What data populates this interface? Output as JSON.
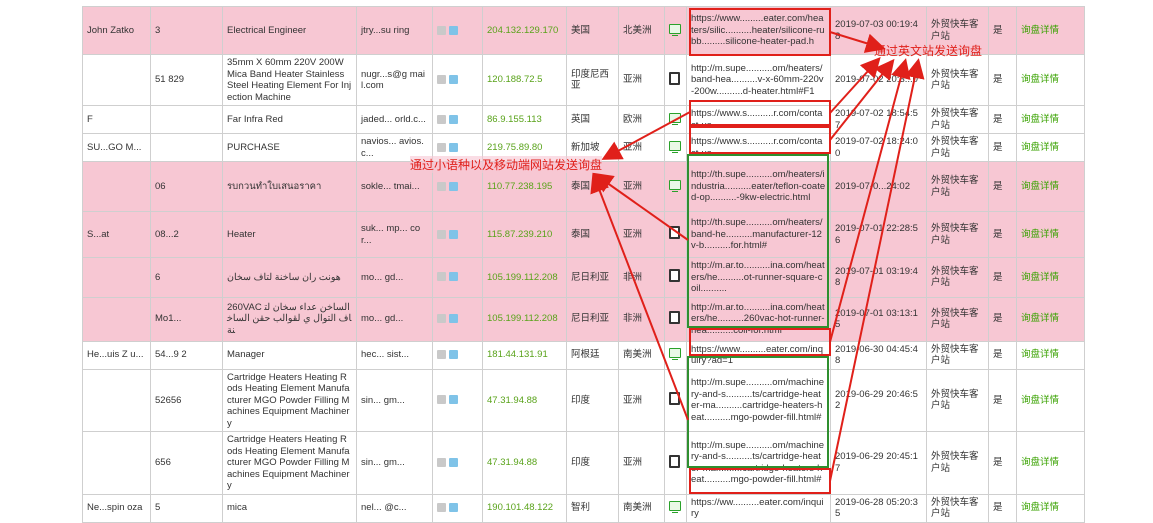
{
  "rows": [
    {
      "style": "pink",
      "row_height": 48,
      "name": "John Zatko",
      "phone": "3",
      "title": "Electrical Engineer",
      "email": "jtry...su ring",
      "ip": "204.132.129.170",
      "country": "美国",
      "region": "北美洲",
      "device": "pc",
      "url": "https://www.........eater.com/heaters/silic..........heater/silicone-rubb.........silicone-heater-pad.h",
      "time": "2019-07-03 00:19:48",
      "type": "外贸快车客户站",
      "flag": "是",
      "action": "询盘详情"
    },
    {
      "style": "white",
      "row_height": 44,
      "name": "",
      "phone": "51 829",
      "title": "35mm X 60mm 220V 200W Mica Band Heater Stainless Steel Heating Element For Injection Machine",
      "email": "nugr...s@g mail.com",
      "ip": "120.188.72.5",
      "country": "印度尼西亚",
      "region": "亚洲",
      "device": "mobile",
      "url": "http://m.supe..........om/heaters/band-hea..........v-x-60mm-220v-200w..........d-heater.html#F1",
      "time": "2019-07-02 20:3...0",
      "type": "外贸快车客户站",
      "flag": "是",
      "action": "询盘详情"
    },
    {
      "style": "white",
      "row_height": 26,
      "name": "F",
      "phone": "",
      "title": "Far Infra Red",
      "email": "jaded... orld.c...",
      "ip": "86.9.155.113",
      "country": "英国",
      "region": "欧洲",
      "device": "pc",
      "url": "https://www.s..........r.com/contact-us",
      "time": "2019-07-02 18:54:57",
      "type": "外贸快车客户站",
      "flag": "是",
      "action": "询盘详情"
    },
    {
      "style": "white",
      "row_height": 28,
      "name": "SU...GO M...",
      "phone": "",
      "title": "PURCHASE",
      "email": "navios... avios.c...",
      "ip": "219.75.89.80",
      "country": "新加坡",
      "region": "亚洲",
      "device": "pc",
      "url": "https://www.s..........r.com/contact-us",
      "time": "2019-07-02 18:24:00",
      "type": "外贸快车客户站",
      "flag": "是",
      "action": "询盘详情"
    },
    {
      "style": "pink",
      "row_height": 50,
      "name": "",
      "phone": "06",
      "title": "รบกวนทำใบเสนอราคา",
      "email": "sokle... tmai...",
      "ip": "110.77.238.195",
      "country": "泰国",
      "region": "亚洲",
      "device": "pc",
      "url": "http://th.supe..........om/heaters/industria..........eater/teflon-coated-op..........-9kw-electric.html",
      "time": "2019-07-0...24:02",
      "type": "外贸快车客户站",
      "flag": "是",
      "action": "询盘详情"
    },
    {
      "style": "pink",
      "row_height": 46,
      "name": "S...at",
      "phone": "08...2",
      "title": "Heater",
      "email": "suk... mp... cor...",
      "ip": "115.87.239.210",
      "country": "泰国",
      "region": "亚洲",
      "device": "mobile",
      "url": "http://th.supe..........om/heaters/band-he..........manufacturer-12v-b..........for.html#",
      "time": "2019-07-01 22:28:56",
      "type": "外贸快车客户站",
      "flag": "是",
      "action": "询盘详情"
    },
    {
      "style": "pink",
      "row_height": 38,
      "name": "",
      "phone": "6",
      "title": "هونت ران ساخنة لتاف سخان",
      "email": "mo... gd...",
      "ip": "105.199.112.208",
      "country": "尼日利亚",
      "region": "非洲",
      "device": "mobile",
      "url": "http://m.ar.to..........ina.com/heaters/he..........ot-runner-square-coil..........",
      "time": "2019-07-01 03:19:48",
      "type": "外贸快车客户站",
      "flag": "是",
      "action": "询盘详情"
    },
    {
      "style": "pink",
      "row_height": 44,
      "name": "",
      "phone": "Mo1...",
      "title": "260VAC الساخن عداء سخان لتاف التوال ي لقوالب حقن الساخنة",
      "email": "mo... gd...",
      "ip": "105.199.112.208",
      "country": "尼日利亚",
      "region": "非洲",
      "device": "mobile",
      "url": "http://m.ar.to..........ina.com/heaters/he..........260vac-hot-runner-hea..........coil-for.html",
      "time": "2019-07-01 03:13:15",
      "type": "外贸快车客户站",
      "flag": "是",
      "action": "询盘详情"
    },
    {
      "style": "white",
      "row_height": 28,
      "name": "He...uis Z u...",
      "phone": "54...9 2",
      "title": "Manager",
      "email": "hec... sist...",
      "ip": "181.44.131.91",
      "country": "阿根廷",
      "region": "南美洲",
      "device": "pc",
      "url": "https://www..........eater.com/inquiry?ad=1",
      "time": "2019-06-30 04:45:48",
      "type": "外贸快车客户站",
      "flag": "是",
      "action": "询盘详情"
    },
    {
      "style": "white",
      "row_height": 56,
      "name": "",
      "phone": "52656",
      "title": "Cartridge Heaters Heating Rods Heating Element Manufacturer MGO Powder Filling Machines Equipment Machinery",
      "email": "sin... gm...",
      "ip": "47.31.94.88",
      "country": "印度",
      "region": "亚洲",
      "device": "mobile",
      "url": "http://m.supe..........om/machinery-and-s..........ts/cartridge-heater-ma..........cartridge-heaters-heat..........mgo-powder-fill.html#",
      "time": "2019-06-29 20:46:52",
      "type": "外贸快车客户站",
      "flag": "是",
      "action": "询盘详情"
    },
    {
      "style": "white",
      "row_height": 56,
      "name": "",
      "phone": "656",
      "title": "Cartridge Heaters Heating Rods Heating Element Manufacturer MGO Powder Filling Machines Equipment Machinery",
      "email": "sin... gm...",
      "ip": "47.31.94.88",
      "country": "印度",
      "region": "亚洲",
      "device": "mobile",
      "url": "http://m.supe..........om/machinery-and-s..........ts/cartridge-heater-ma..........cartridge-heaters-heat..........mgo-powder-fill.html#",
      "time": "2019-06-29 20:45:17",
      "type": "外贸快车客户站",
      "flag": "是",
      "action": "询盘详情"
    },
    {
      "style": "white",
      "row_height": 26,
      "name": "Ne...spin oza",
      "phone": "5",
      "title": "mica",
      "email": "nel... @c...",
      "ip": "190.101.48.122",
      "country": "智利",
      "region": "南美洲",
      "device": "pc",
      "url": "https://ww..........eater.com/inquiry",
      "time": "2019-06-28 05:20:35",
      "type": "外贸快车客户站",
      "flag": "是",
      "action": "询盘详情"
    }
  ],
  "annotations": {
    "english_label": "通过英文站发送询盘",
    "minor_label": "通过小语种以及移动端网站发送询盘",
    "color": "#e0201a"
  }
}
